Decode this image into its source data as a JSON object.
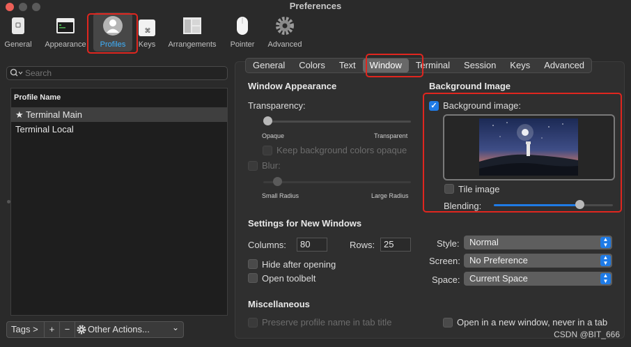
{
  "window": {
    "title": "Preferences"
  },
  "toolbar": {
    "items": [
      {
        "label": "General",
        "icon": "general-icon"
      },
      {
        "label": "Appearance",
        "icon": "appearance-icon"
      },
      {
        "label": "Profiles",
        "icon": "profiles-icon",
        "selected": true
      },
      {
        "label": "Keys",
        "icon": "keys-icon"
      },
      {
        "label": "Arrangements",
        "icon": "arrangements-icon"
      },
      {
        "label": "Pointer",
        "icon": "pointer-icon"
      },
      {
        "label": "Advanced",
        "icon": "advanced-icon"
      }
    ]
  },
  "sidebar": {
    "search_placeholder": "Search",
    "header": "Profile Name",
    "profiles": [
      {
        "label": "★ Terminal Main",
        "selected": true
      },
      {
        "label": "Terminal Local",
        "selected": false
      }
    ],
    "bottom": {
      "tags": "Tags >",
      "add": "+",
      "remove": "−",
      "other": "Other Actions...",
      "chevron": "⌄"
    }
  },
  "tabs": {
    "items": [
      "General",
      "Colors",
      "Text",
      "Window",
      "Terminal",
      "Session",
      "Keys",
      "Advanced"
    ],
    "selected": "Window"
  },
  "appearance": {
    "title": "Window Appearance",
    "transparency": "Transparency:",
    "opaque": "Opaque",
    "transparent": "Transparent",
    "keep_bg": "Keep background colors opaque",
    "blur": "Blur:",
    "small_radius": "Small Radius",
    "large_radius": "Large Radius"
  },
  "background": {
    "title": "Background Image",
    "checkbox_label": "Background image:",
    "checked": true,
    "tile": "Tile image",
    "blending": "Blending:",
    "blending_level": 0.74
  },
  "new_windows": {
    "title": "Settings for New Windows",
    "columns_label": "Columns:",
    "columns": "80",
    "rows_label": "Rows:",
    "rows": "25",
    "hide": "Hide after opening",
    "toolbelt": "Open toolbelt",
    "style_label": "Style:",
    "style": "Normal",
    "screen_label": "Screen:",
    "screen": "No Preference",
    "space_label": "Space:",
    "space": "Current Space"
  },
  "misc": {
    "title": "Miscellaneous",
    "preserve": "Preserve profile name in tab title",
    "new_window": "Open in a new window, never in a tab"
  },
  "watermark": "CSDN @BIT_666",
  "colors": {
    "accent": "#1f7be6",
    "highlight": "#e0261f",
    "selected_label": "#3fb3ff"
  }
}
